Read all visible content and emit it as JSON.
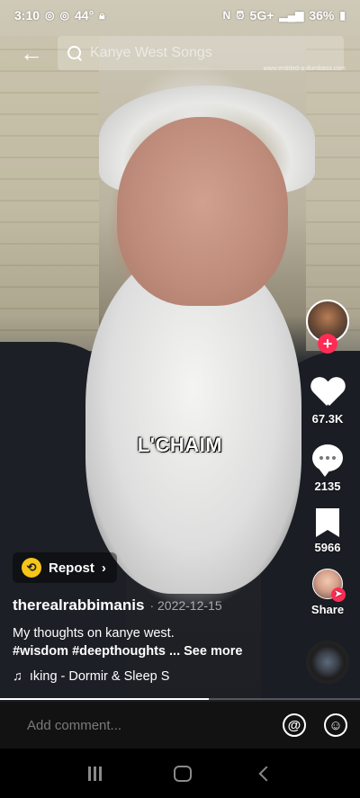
{
  "status_bar": {
    "time": "3:10",
    "temperature": "44°",
    "network": "5G+",
    "battery": "36%"
  },
  "search": {
    "back_icon": "arrow-left-icon",
    "query": "Kanye West Songs",
    "watermark": "www.entitled-a-dumbass.com"
  },
  "video": {
    "caption": "L'CHAIM"
  },
  "actions": {
    "likes": "67.3K",
    "comments": "2135",
    "saves": "5966",
    "share_label": "Share",
    "follow_icon": "plus-icon"
  },
  "post": {
    "repost_label": "Repost",
    "author": "therealrabbimanis",
    "date": "· 2022-12-15",
    "description": "My thoughts on kanye west.",
    "hashtags": "#wisdom #deepthoughts ...",
    "see_more": "See more",
    "music": "ıking - Dormir & Sleep S"
  },
  "progress": 0.58,
  "comment_bar": {
    "placeholder": "Add comment...",
    "mention_icon": "at-icon",
    "emoji_icon": "emoji-icon"
  },
  "colors": {
    "accent": "#fe2c55",
    "repost_badge": "#f5c518"
  }
}
